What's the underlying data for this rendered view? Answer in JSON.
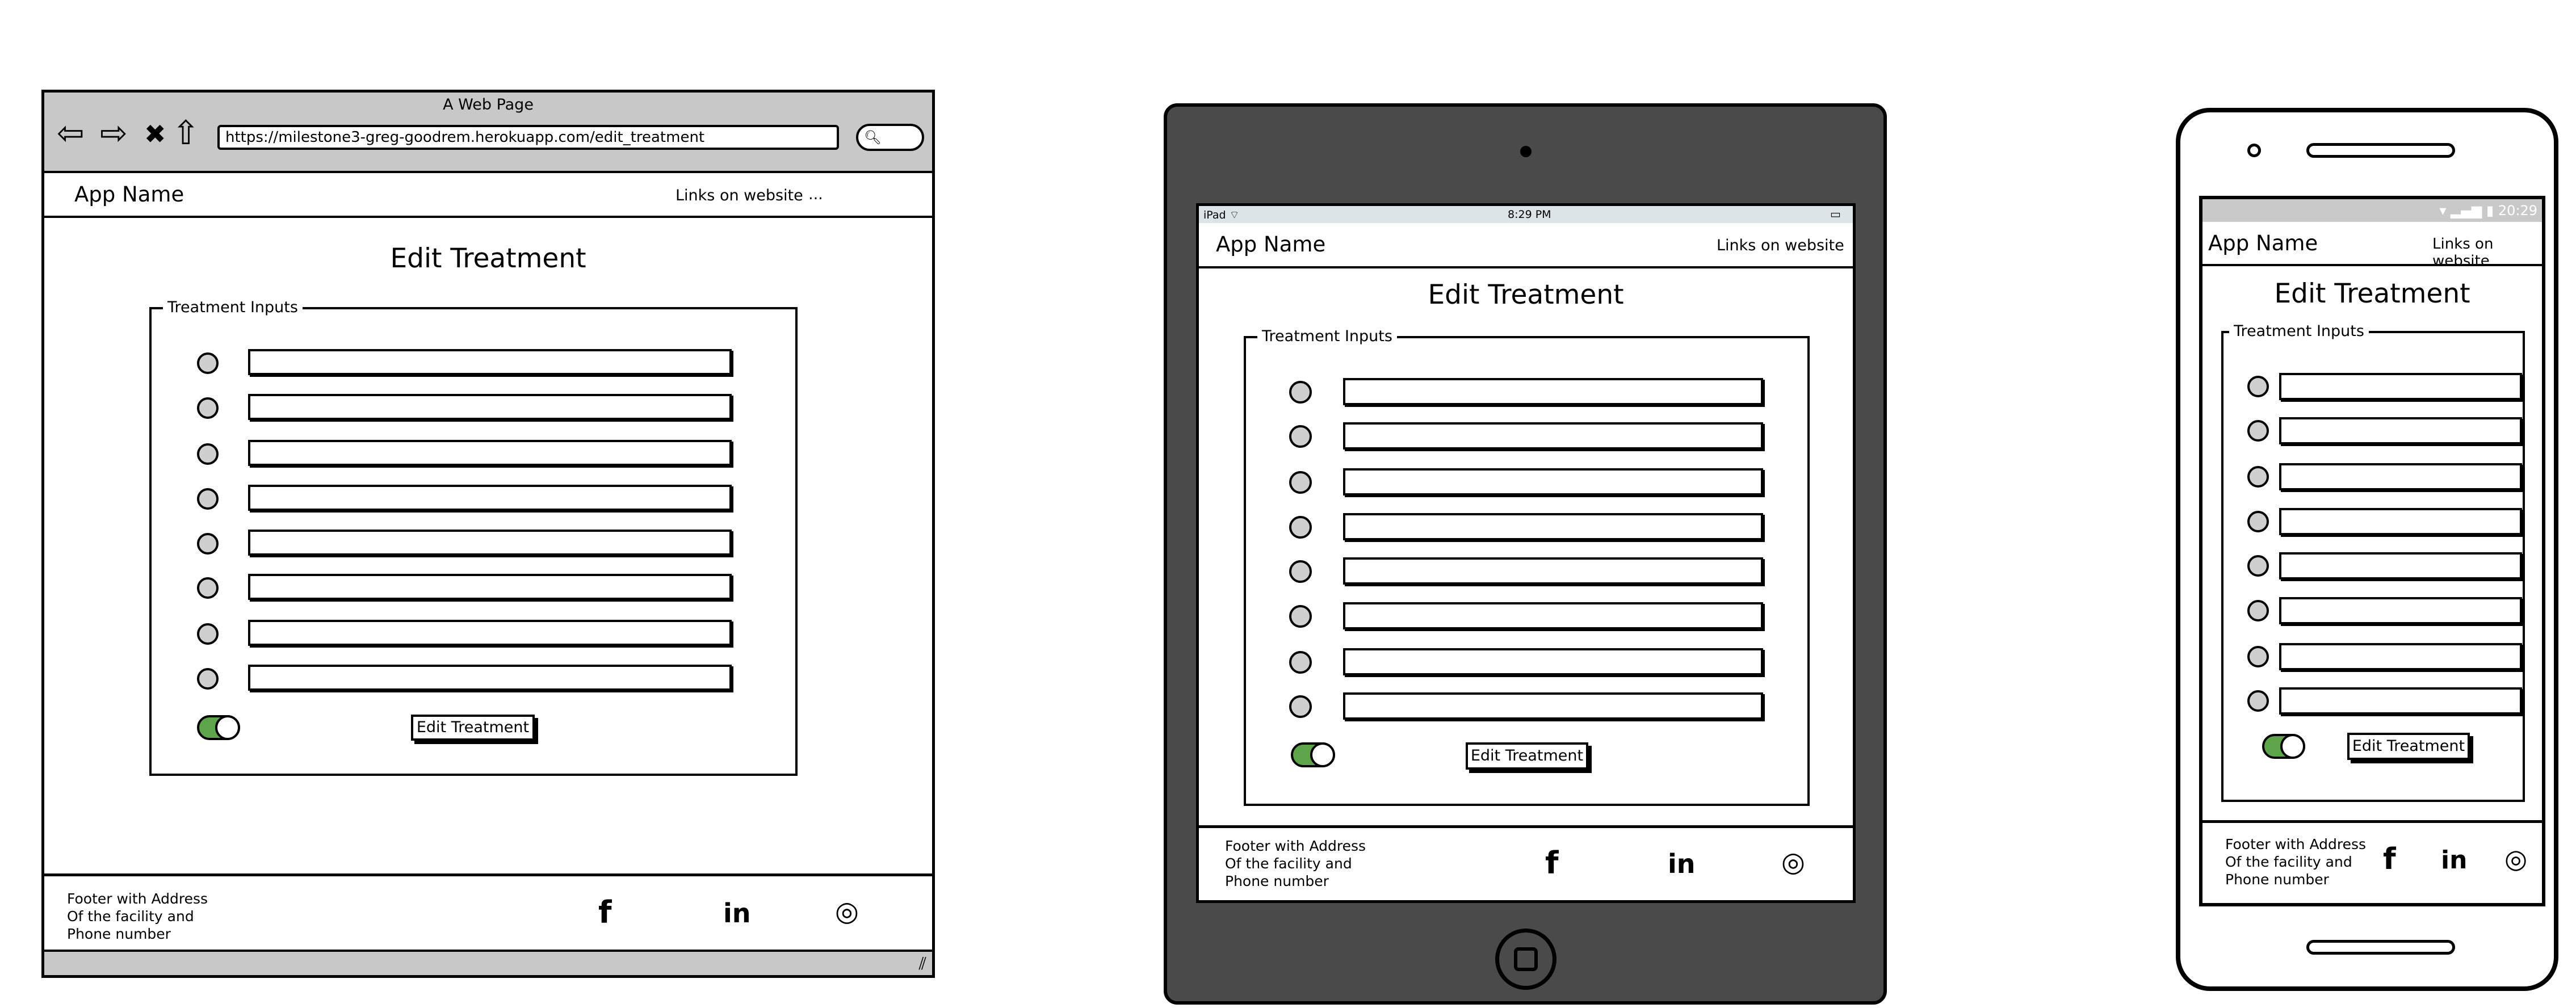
{
  "browser": {
    "window_title": "A Web Page",
    "url": "https://milestone3-greg-goodrem.herokuapp.com/edit_treatment",
    "nav_icons": {
      "back": "⇦",
      "forward": "⇨",
      "stop": "✖",
      "home": "⇧",
      "search": "🔍︎",
      "resize": "⫽"
    },
    "app_name": "App Name",
    "links": "Links on website",
    "more": "...",
    "heading": "Edit Treatment",
    "legend": "Treatment Inputs",
    "button": "Edit Treatment",
    "footer": [
      "Footer with Address",
      "Of the facility and",
      "Phone number"
    ],
    "social": [
      "f",
      "in",
      "◎"
    ]
  },
  "tablet": {
    "status_left": "iPad ⌔",
    "status_time": "8:29 PM",
    "battery": "▭",
    "app_name": "App Name",
    "links": "Links on website",
    "heading": "Edit Treatment",
    "legend": "Treatment Inputs",
    "button": "Edit Treatment",
    "footer": [
      "Footer with Address",
      "Of the facility and",
      "Phone number"
    ],
    "social": [
      "f",
      "in",
      "◎"
    ]
  },
  "phone": {
    "status_right": "▾ ▂▄▆ ▮ 20:29",
    "app_name": "App Name",
    "links": "Links on website",
    "heading": "Edit Treatment",
    "legend": "Treatment Inputs",
    "button": "Edit Treatment",
    "footer": [
      "Footer with Address",
      "Of the facility and",
      "Phone number"
    ],
    "social": [
      "f",
      "in",
      "◎"
    ]
  },
  "toggle_state": "on",
  "colors": {
    "frame": "#4a4a4a",
    "chrome": "#c8c8c8",
    "toggle_on": "#5ea44a",
    "radio": "#cfcfcf"
  },
  "rows_per_form": 8
}
